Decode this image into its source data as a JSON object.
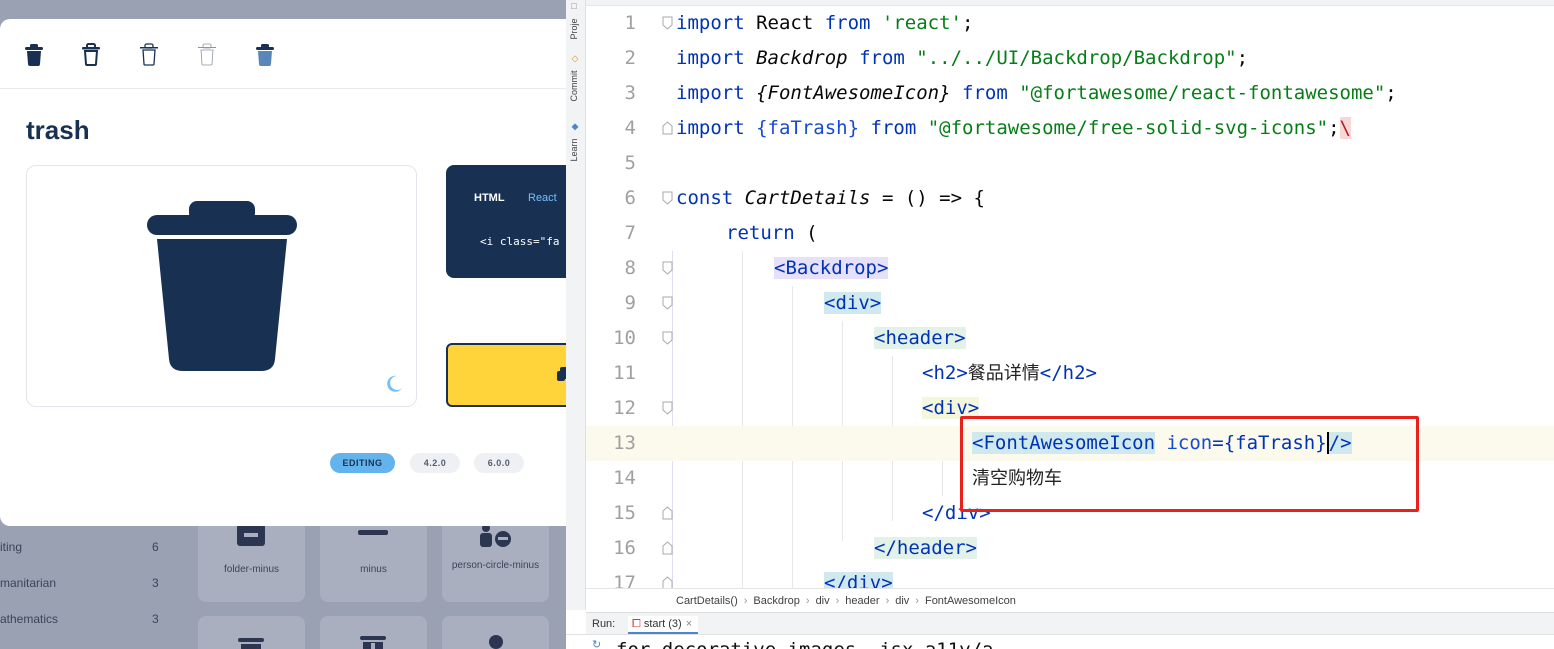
{
  "fa_page": {
    "categories": [
      {
        "label": "iting",
        "count": "6"
      },
      {
        "label": "manitarian",
        "count": "3"
      },
      {
        "label": "athematics",
        "count": "3"
      }
    ],
    "tiles": [
      {
        "label": "folder-minus",
        "icon": "folder-minus-icon"
      },
      {
        "label": "minus",
        "icon": "minus-icon"
      },
      {
        "label": "person-circle-minus",
        "icon": "person-circle-minus-icon"
      }
    ],
    "modal": {
      "style_buttons": [
        "trash-solid-icon",
        "trash-regular-icon",
        "trash-light-icon",
        "trash-thin-icon",
        "trash-duotone-icon"
      ],
      "title": "trash",
      "code_tabs": {
        "html": "HTML",
        "react": "React"
      },
      "snippet": "<i class=\"fa",
      "versions": {
        "editing": "EDITING",
        "v42": "4.2.0",
        "v60": "6.0.0"
      },
      "colors": {
        "brand": "#183153",
        "accent": "#ffd43b",
        "blue": "#63b3ed"
      }
    }
  },
  "ide": {
    "side_tabs": {
      "project": "Proje",
      "commit": "Commit",
      "learn": "Learn"
    },
    "lines": [
      {
        "n": "1"
      },
      {
        "n": "2"
      },
      {
        "n": "3"
      },
      {
        "n": "4"
      },
      {
        "n": "5"
      },
      {
        "n": "6"
      },
      {
        "n": "7"
      },
      {
        "n": "8"
      },
      {
        "n": "9"
      },
      {
        "n": "10"
      },
      {
        "n": "11"
      },
      {
        "n": "12"
      },
      {
        "n": "13"
      },
      {
        "n": "14"
      },
      {
        "n": "15"
      },
      {
        "n": "16"
      },
      {
        "n": "17"
      }
    ],
    "code": {
      "l1_kw": "import",
      "l1_id": " React ",
      "l1_from": "from",
      "l1_str": " 'react'",
      "l1_end": ";",
      "l2_kw": "import",
      "l2_id": "Backdrop",
      "l2_from": "from",
      "l2_str": "\"../../UI/Backdrop/Backdrop\"",
      "l2_end": ";",
      "l3_kw": "import",
      "l3_id": "{FontAwesomeIcon}",
      "l3_from": "from",
      "l3_str": "\"@fortawesome/react-fontawesome\"",
      "l3_end": ";",
      "l4_kw": "import",
      "l4_id": "{faTrash}",
      "l4_from": "from",
      "l4_str": "\"@fortawesome/free-solid-svg-icons\"",
      "l4_end": ";",
      "l4_err": "\\",
      "l6_kw": "const",
      "l6_id": "CartDetails",
      "l6_rest": " = () => {",
      "l7_kw": "return",
      "l7_rest": " (",
      "l8_tag": "<Backdrop>",
      "l9_tag": "<div>",
      "l10_tag": "<header>",
      "l11_open": "<h2>",
      "l11_text": "餐品详情",
      "l11_close": "</h2>",
      "l12_tag": "<div>",
      "l13_open": "<FontAwesomeIcon",
      "l13_attr": "icon",
      "l13_val": "={faTrash}",
      "l13_close": "/>",
      "l14_text": "清空购物车",
      "l15_tag": "</div>",
      "l16_tag": "</header>",
      "l17_tag": "</div>"
    },
    "breadcrumb": [
      "CartDetails()",
      "Backdrop",
      "div",
      "header",
      "div",
      "FontAwesomeIcon"
    ],
    "run": {
      "label": "Run:",
      "tab": "start (3)",
      "close": "×"
    },
    "console": "for decorative images, jsx-a11y/a"
  }
}
